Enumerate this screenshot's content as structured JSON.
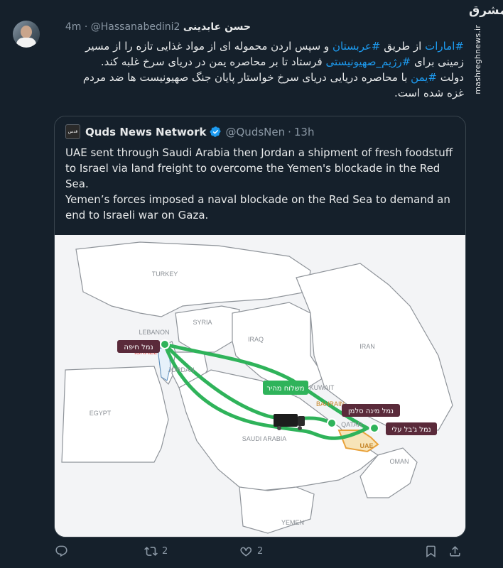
{
  "tweet": {
    "author_name": "حسن عابدینی",
    "handle": "@Hassanabedini2",
    "separator": "·",
    "time": "4m",
    "text_lines": [
      [
        "#امارات",
        " از طریق ",
        "#عربستان",
        " و سپس اردن محموله ای از مواد غذایی تازه را از مسیر"
      ],
      [
        "زمینی برای ",
        "#رژیم_صهیونیستی",
        " فرستاد تا بر محاصره یمن در دریای سرخ غلبه کند."
      ],
      [
        "دولت ",
        "#یمن",
        " با محاصره دریایی دریای سرخ خواستار پایان جنگ صهیونیست ها ضد مردم"
      ],
      [
        "غزه شده است."
      ]
    ]
  },
  "watermark": {
    "logo_text": "مشرق",
    "site": "mashreghnews.ir"
  },
  "quote": {
    "logo_text": "قدس",
    "name": "Quds News Network",
    "handle": "@QudsNen",
    "separator": "·",
    "time": "13h",
    "paragraphs": [
      "UAE sent through Saudi Arabia then Jordan a shipment of fresh foodstuff to Israel via land freight to overcome the Yemen's blockade in the Red Sea.",
      "Yemen’s forces imposed a naval blockade on the Red Sea to demand an end to Israeli war on Gaza."
    ]
  },
  "map": {
    "countries": [
      "TURKEY",
      "SYRIA",
      "LEBANON",
      "ISRAEL",
      "IRAQ",
      "IRAN",
      "JORDAN",
      "EGYPT",
      "SAUDI ARABIA",
      "BAHRAIN",
      "QATAR",
      "UAE",
      "OMAN",
      "YEMEN",
      "KUWAIT"
    ],
    "callouts": {
      "haifa": "נמל חיפה",
      "shipment": "משלוח מהיר",
      "bahrain_port": "נמל מינה סלמן",
      "dubai_port": "נמל ג'בל עלי"
    },
    "colors": {
      "route": "#2fb35a",
      "callout_bg": "#5a2a3a",
      "shipment_bg": "#2fb35a",
      "uae_fill": "#e9a23b"
    }
  },
  "actions": {
    "reply_count": "",
    "retweet_count": "2",
    "like_count": "2"
  }
}
